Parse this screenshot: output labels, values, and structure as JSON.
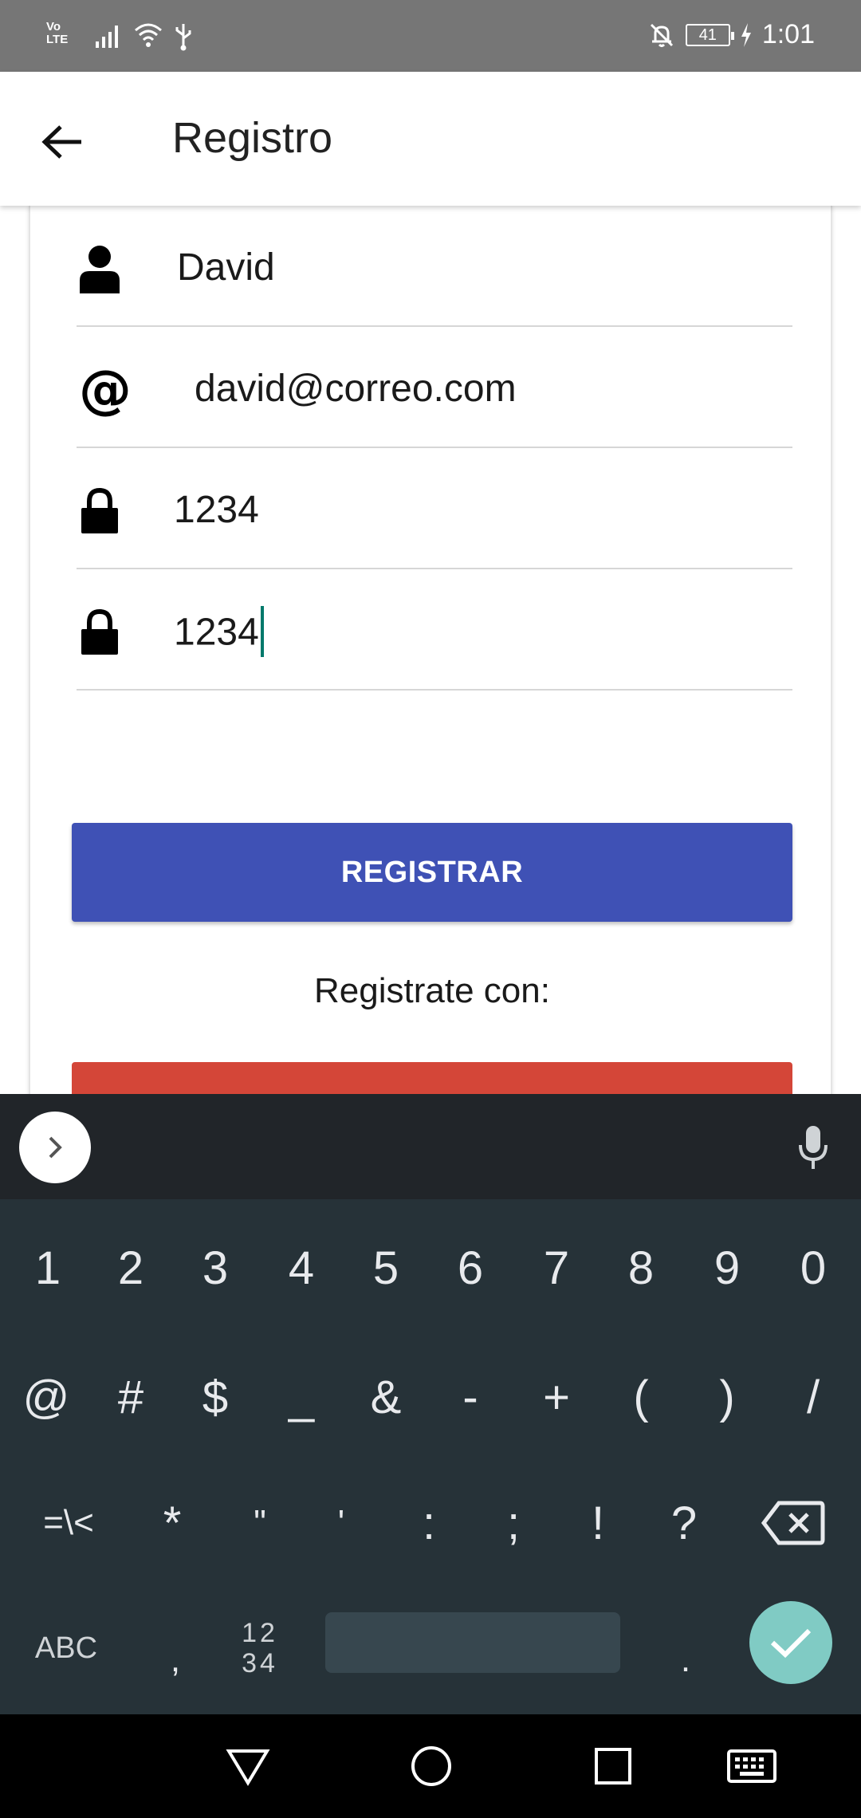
{
  "status_bar": {
    "network_label": "Vo\nLTE",
    "battery_level": "41",
    "time": "1:01",
    "icons": [
      "volte-icon",
      "signal-icon",
      "wifi-icon",
      "usb-icon",
      "bell-off-icon",
      "battery-icon",
      "charging-icon"
    ]
  },
  "app_bar": {
    "title": "Registro",
    "back_icon": "arrow-left-icon"
  },
  "form": {
    "name_value": "David",
    "email_value": "david@correo.com",
    "password_value": "1234",
    "confirm_password_value": "1234",
    "register_button_label": "REGISTRAR",
    "register_with_label": "Registrate con:"
  },
  "keyboard": {
    "row1": [
      "1",
      "2",
      "3",
      "4",
      "5",
      "6",
      "7",
      "8",
      "9",
      "0"
    ],
    "row2": [
      "@",
      "#",
      "$",
      "_",
      "&",
      "-",
      "+",
      "(",
      ")",
      "/"
    ],
    "row3": [
      "=\\<",
      "*",
      "\"",
      "'",
      ":",
      ";",
      "!",
      "?"
    ],
    "abc_label": "ABC",
    "comma_label": ",",
    "numeric_label": "12\n34",
    "period_label": "."
  },
  "nav_bar": {
    "icons": [
      "back-triangle-icon",
      "home-circle-icon",
      "recents-square-icon",
      "keyboard-icon"
    ]
  },
  "colors": {
    "status_bar": "#767676",
    "primary_button": "#3f51b5",
    "social_button": "#d44638",
    "keyboard_bg": "#263238",
    "done_key": "#80cbc4",
    "cursor": "#00796b"
  }
}
